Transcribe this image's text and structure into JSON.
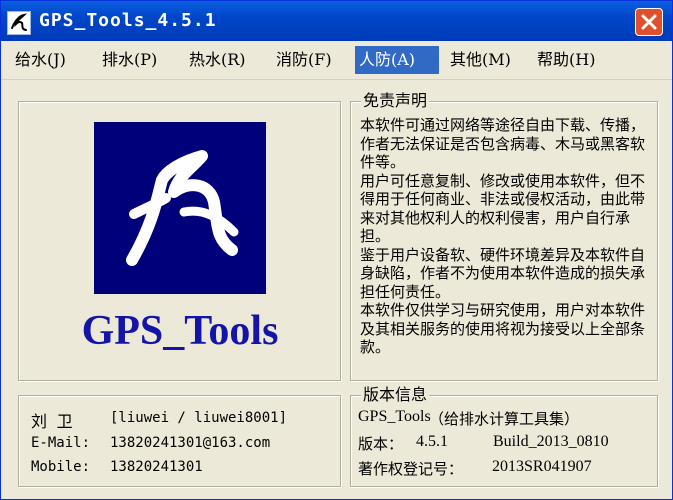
{
  "window": {
    "title": "GPS_Tools_4.5.1",
    "close_symbol": "✕"
  },
  "menu": [
    {
      "label": "给水(J)"
    },
    {
      "label": "排水(P)"
    },
    {
      "label": "热水(R)"
    },
    {
      "label": "消防(F)"
    },
    {
      "label": "人防(A)"
    },
    {
      "label": "其他(M)"
    },
    {
      "label": "帮助(H)"
    }
  ],
  "logo": {
    "brand": "GPS_Tools",
    "background_color": "#00007a",
    "brand_color": "#1414a8"
  },
  "disclaimer": {
    "title": "免责声明",
    "paragraphs": [
      "本软件可通过网络等途径自由下载、传播，作者无法保证是否包含病毒、木马或黑客软件等。",
      "用户可任意复制、修改或使用本软件，但不得用于任何商业、非法或侵权活动，由此带来对其他权利人的权利侵害，用户自行承担。",
      "鉴于用户设备软、硬件环境差异及本软件自身缺陷，作者不为使用本软件造成的损失承担任何责任。",
      "本软件仅供学习与研究使用，用户对本软件及其相关服务的使用将视为接受以上全部条款。"
    ]
  },
  "contact": {
    "name": "刘  卫",
    "handle": "[liuwei / liuwei8001]",
    "email_label": "E-Mail:",
    "email": "13820241301@163.com",
    "mobile_label": "Mobile:",
    "mobile": "13820241301"
  },
  "version_info": {
    "title": "版本信息",
    "app_name": "GPS_Tools",
    "app_desc": "（给排水计算工具集）",
    "version_label": "版本：",
    "version": "4.5.1",
    "build": "Build_2013_0810",
    "copyright_label": "著作权登记号：",
    "copyright_no": "2013SR041907"
  }
}
